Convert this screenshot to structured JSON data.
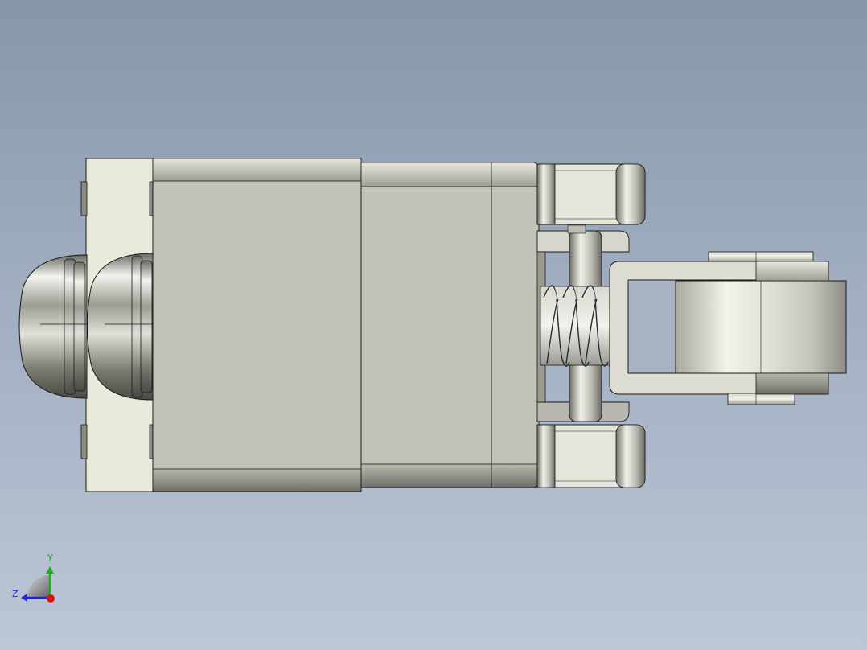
{
  "viewport": {
    "background_top": "#8796aa",
    "background_bottom": "#bcc6d6"
  },
  "model": {
    "body_color": "#c3c3ba",
    "flange_color": "#e9e9dd",
    "edge_color": "#1a1a1a",
    "metal_color": "#c8c8c2"
  },
  "triad": {
    "y_label": "Y",
    "z_label": "Z",
    "y_color": "#22aa22",
    "z_color": "#1a2ad0",
    "x_color": "#dd1111"
  }
}
